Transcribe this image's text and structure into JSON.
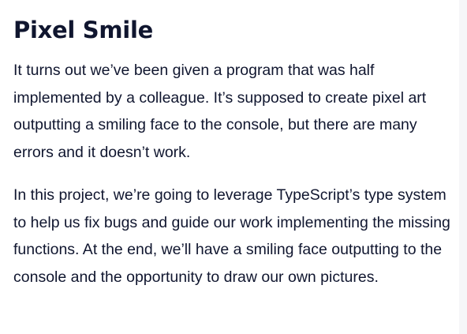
{
  "article": {
    "title": "Pixel Smile",
    "paragraphs": [
      "It turns out we’ve been given a program that was half implemented by a colleague. It’s supposed to create pixel art outputting a smiling face to the console, but there are many errors and it doesn’t work.",
      "In this project, we’re going to leverage TypeScript’s type system to help us fix bugs and guide our work implementing the missing functions. At the end, we’ll have a smiling face outputting to the console and the opportunity to draw our own pictures."
    ]
  }
}
